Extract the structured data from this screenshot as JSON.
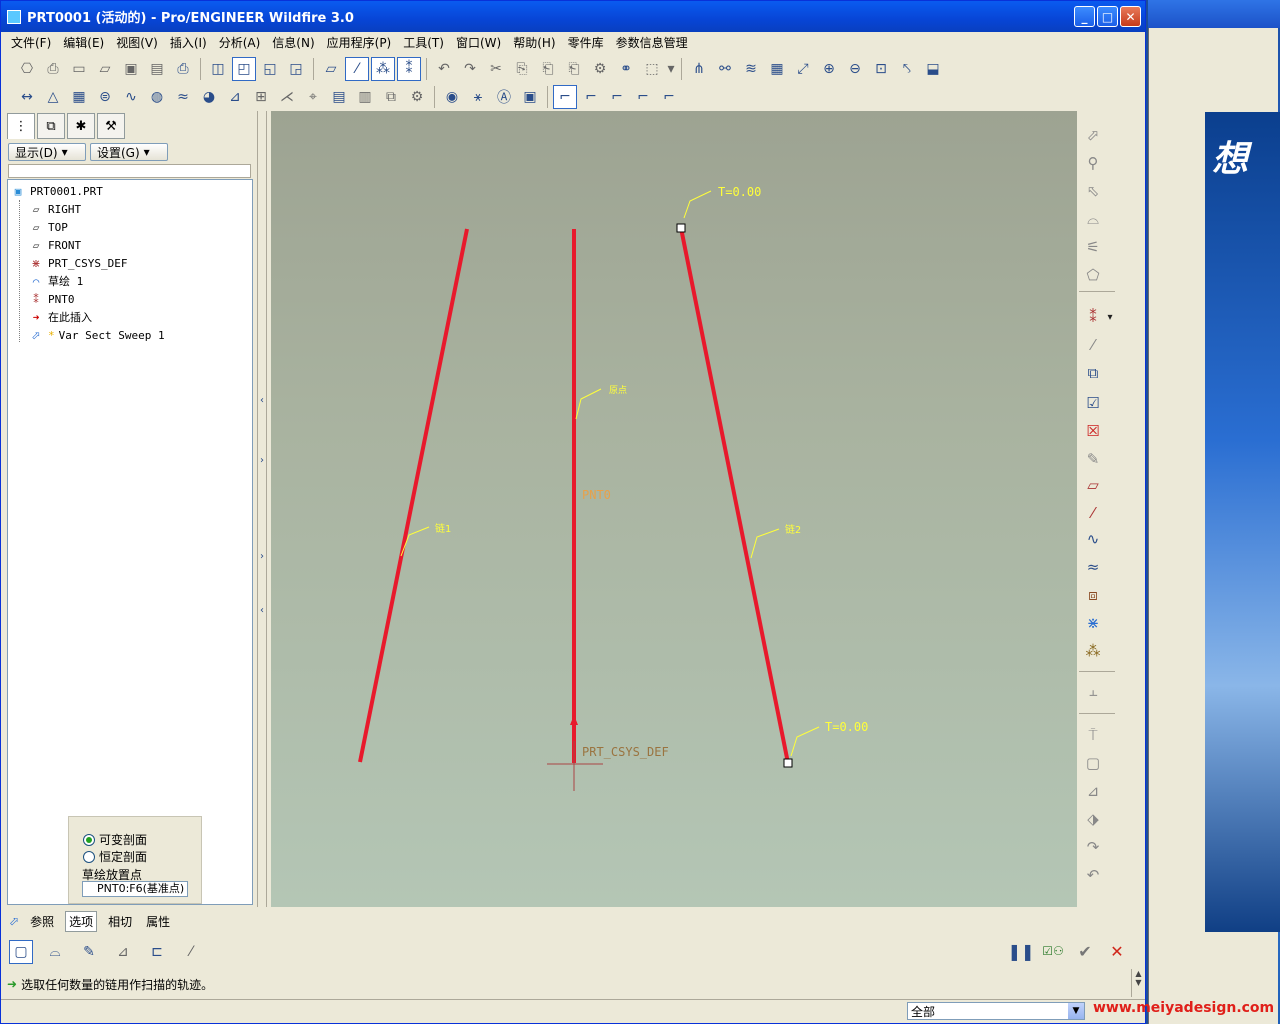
{
  "window": {
    "title": "PRT0001 (活动的) - Pro/ENGINEER Wildfire 3.0"
  },
  "menu": [
    "文件(F)",
    "编辑(E)",
    "视图(V)",
    "插入(I)",
    "分析(A)",
    "信息(N)",
    "应用程序(P)",
    "工具(T)",
    "窗口(W)",
    "帮助(H)",
    "零件库",
    "参数信息管理"
  ],
  "tree": {
    "show_label": "显示(D)",
    "settings_label": "设置(G)",
    "items": [
      {
        "label": "PRT0001.PRT",
        "icon": "part-icon"
      },
      {
        "label": "RIGHT",
        "icon": "datum-plane-icon"
      },
      {
        "label": "TOP",
        "icon": "datum-plane-icon"
      },
      {
        "label": "FRONT",
        "icon": "datum-plane-icon"
      },
      {
        "label": "PRT_CSYS_DEF",
        "icon": "csys-icon"
      },
      {
        "label": "草绘 1",
        "icon": "sketch-icon"
      },
      {
        "label": "PNT0",
        "icon": "datum-point-icon"
      },
      {
        "label": "在此插入",
        "icon": "insert-here-arrow-icon"
      },
      {
        "label": "Var Sect Sweep 1",
        "icon": "var-sect-sweep-icon"
      }
    ]
  },
  "canvas": {
    "labels": {
      "t_top": "T=0.00",
      "t_bottom": "T=0.00",
      "origin": "原点",
      "chain1": "链1",
      "chain2": "链2",
      "pnt0": "PNT0",
      "csys": "PRT_CSYS_DEF"
    },
    "colors": {
      "trajectory": "#e8192c",
      "callout": "#ffff3a",
      "point_label": "#e8a14a"
    }
  },
  "options_panel": {
    "variable_section": "可变剖面",
    "constant_section": "恒定剖面",
    "placement_label": "草绘放置点",
    "placement_value": "PNT0:F6(基准点)",
    "selected": "variable_section"
  },
  "dashboard": {
    "tabs": [
      "参照",
      "选项",
      "相切",
      "属性"
    ],
    "active_tab": "选项"
  },
  "message": "选取任何数量的链用作扫描的轨迹。",
  "status": {
    "filter": "全部",
    "watermark": "www.meiyadesign.com"
  }
}
